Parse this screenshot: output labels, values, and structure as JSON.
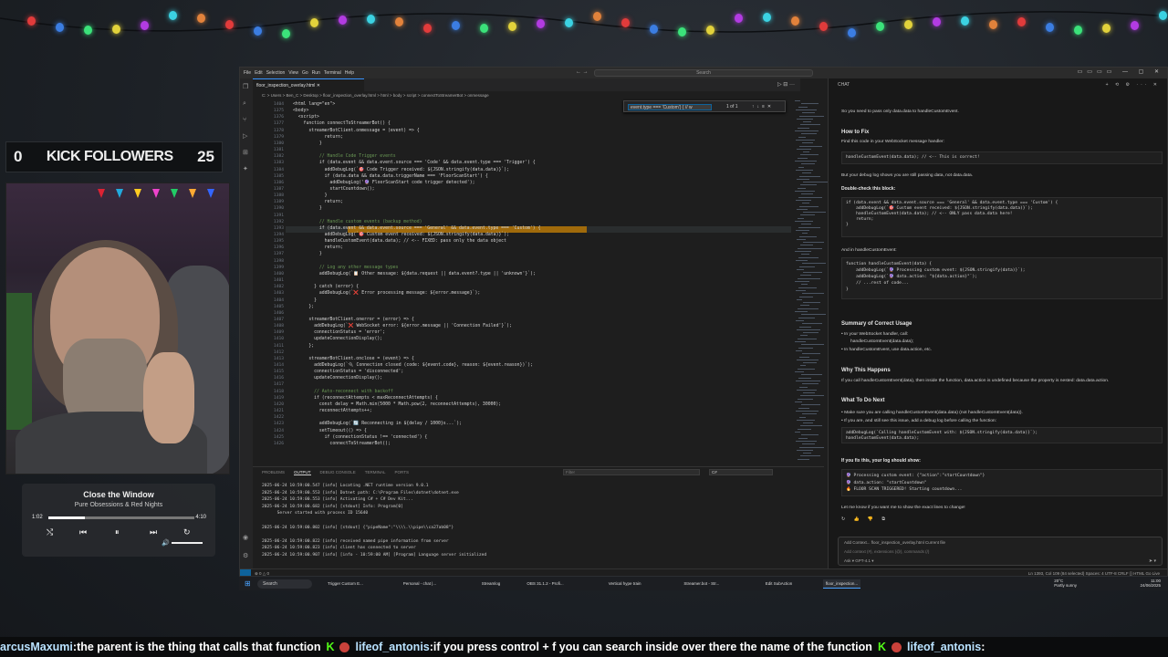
{
  "lights": {
    "colors": [
      "#e23b3b",
      "#3b7de2",
      "#3be27a",
      "#e2d23b",
      "#b23be2",
      "#3bd2e2",
      "#e2823b"
    ]
  },
  "followers": {
    "left": "0",
    "label": "KICK FOLLOWERS",
    "right": "25"
  },
  "player": {
    "title": "Close the Window",
    "artist": "Pure Obsessions & Red Nights",
    "time_current": "1:02",
    "time_total": "4:10",
    "progress": 0.25
  },
  "vscode": {
    "menu": [
      "File",
      "Edit",
      "Selection",
      "View",
      "Go",
      "Run",
      "Terminal",
      "Help"
    ],
    "search_placeholder": "Search",
    "tab": "floor_inspection_overlay.html",
    "breadcrumbs": "C: > Users > Ben_C > Desktop > floor_inspection_overlay.html > html > body > script > connectToStreamerBot > onmessage",
    "find": {
      "query": "event.type === 'Custom') {  // w",
      "count": "1 of 1"
    },
    "code": [
      [
        "1404",
        "<html lang=\"en\">"
      ],
      [
        "1375",
        "<body>"
      ],
      [
        "1376",
        "  <script>"
      ],
      [
        "1377",
        "    function connectToStreamerBot() {"
      ],
      [
        "1378",
        "      streamerBotClient.onmessage = (event) => {"
      ],
      [
        "1379",
        "            return;"
      ],
      [
        "1380",
        "          }"
      ],
      [
        "1381",
        ""
      ],
      [
        "1382",
        "          // Handle Code Trigger events"
      ],
      [
        "1383",
        "          if (data.event && data.event.source === 'Code' && data.event.type === 'Trigger') {"
      ],
      [
        "1384",
        "            addDebugLog(`🎯 Code Trigger received: ${JSON.stringify(data.data)}`);"
      ],
      [
        "1385",
        "            if (data.data && data.data.triggerName === 'FloorScanStart') {"
      ],
      [
        "1386",
        "              addDebugLog('🔮 FloorScanStart code trigger detected');"
      ],
      [
        "1387",
        "              startCountdown();"
      ],
      [
        "1388",
        "            }"
      ],
      [
        "1389",
        "            return;"
      ],
      [
        "1390",
        "          }"
      ],
      [
        "1391",
        ""
      ],
      [
        "1392",
        "          // Handle custom events (backup method)"
      ],
      [
        "1393",
        "          if (data.event && data.event.source === 'General' && data.event.type === 'Custom') {"
      ],
      [
        "1394",
        "            addDebugLog(`🎯 Custom event received: ${JSON.stringify(data.data)}`);"
      ],
      [
        "1395",
        "            handleCustomEvent(data.data); // <-- FIXED: pass only the data object"
      ],
      [
        "1396",
        "            return;"
      ],
      [
        "1397",
        "          }"
      ],
      [
        "1398",
        ""
      ],
      [
        "1399",
        "          // Log any other message types"
      ],
      [
        "1400",
        "          addDebugLog(`📋 Other message: ${data.request || data.event?.type || 'unknown'}`);"
      ],
      [
        "1401",
        ""
      ],
      [
        "1402",
        "        } catch (error) {"
      ],
      [
        "1403",
        "          addDebugLog(`❌ Error processing message: ${error.message}`);"
      ],
      [
        "1404",
        "        }"
      ],
      [
        "1405",
        "      };"
      ],
      [
        "1406",
        ""
      ],
      [
        "1407",
        "      streamerBotClient.onerror = (error) => {"
      ],
      [
        "1408",
        "        addDebugLog(`❌ WebSocket error: ${error.message || 'Connection Failed'}`);"
      ],
      [
        "1409",
        "        connectionStatus = 'error';"
      ],
      [
        "1410",
        "        updateConnectionDisplay();"
      ],
      [
        "1411",
        "      };"
      ],
      [
        "1412",
        ""
      ],
      [
        "1413",
        "      streamerBotClient.onclose = (event) => {"
      ],
      [
        "1414",
        "        addDebugLog(`🔌 Connection closed (code: ${event.code}, reason: ${event.reason})`);"
      ],
      [
        "1415",
        "        connectionStatus = 'disconnected';"
      ],
      [
        "1416",
        "        updateConnectionDisplay();"
      ],
      [
        "1417",
        ""
      ],
      [
        "1418",
        "        // Auto-reconnect with backoff"
      ],
      [
        "1419",
        "        if (reconnectAttempts < maxReconnectAttempts) {"
      ],
      [
        "1420",
        "          const delay = Math.min(5000 * Math.pow(2, reconnectAttempts), 30000);"
      ],
      [
        "1421",
        "          reconnectAttempts++;"
      ],
      [
        "1422",
        ""
      ],
      [
        "1423",
        "          addDebugLog(`🔄 Reconnecting in ${delay / 1000}s...`);"
      ],
      [
        "1424",
        "          setTimeout(() => {"
      ],
      [
        "1425",
        "            if (connectionStatus !== 'connected') {"
      ],
      [
        "1426",
        "              connectToStreamerBot();"
      ]
    ],
    "panel_tabs": [
      "PROBLEMS",
      "OUTPUT",
      "DEBUG CONSOLE",
      "TERMINAL",
      "PORTS"
    ],
    "filter_placeholder": "Filter",
    "output_source": "C#",
    "output": [
      "2025-06-24 10:59:00.547 [info] Locating .NET runtime version 9.0.1",
      "2025-06-24 10:59:00.553 [info] Dotnet path: C:\\Program Files\\dotnet\\dotnet.exe",
      "2025-06-24 10:59:00.553 [info] Activating C# + C# Dev Kit...",
      "2025-06-24 10:59:00.682 [info] [stdout] Info: Program[0]",
      "      Server started with process ID 15640",
      "",
      "2025-06-24 10:59:00.802 [info] [stdout] {\"pipeName\":\"\\\\\\\\.\\\\pipe\\\\ca27ab08\"}",
      "",
      "2025-06-24 10:59:00.822 [info] received named pipe information from server",
      "2025-06-24 10:59:00.823 [info] client has connected to server",
      "2025-06-24 10:59:00.907 [info] [info - 10:59:00 AM] [Program] Language server initialized"
    ],
    "status_left": "⊗ 0 △ 0",
    "status_right": "Ln 1393, Col 109 (84 selected)   Spaces: 4   UTF-8   CRLF   {} HTML   Go Live"
  },
  "chat": {
    "header": "CHAT",
    "intro": "So you need to pass only data.data to handleCustomEvent.",
    "h_fix": "How to Fix",
    "fix_text": "Find this code in your WebSocket message handler:",
    "fix_code": "handleCustomEvent(data.data); // <-- This is correct!",
    "fix_after": "But your debug log shows you are still passing data, not data.data.",
    "h_double": "Double-check this block:",
    "double_code": "if (data.event && data.event.source === 'General' && data.event.type === 'Custom') {\n    addDebugLog(`🎯 Custom event received: ${JSON.stringify(data.data)}`);\n    handleCustomEvent(data.data); // <-- ONLY pass data.data here!\n    return;\n}",
    "and_in": "And in handleCustomEvent:",
    "handler_code": "function handleCustomEvent(data) {\n    addDebugLog(`🔮 Processing custom event: ${JSON.stringify(data)}`);\n    addDebugLog(`🔮 data.action: \"${data.action}\"`);\n    // ...rest of code...\n}",
    "h_summary": "Summary of Correct Usage",
    "summary_1": "In your WebSocket handler, call:",
    "summary_1b": "handleCustomEvent(data.data);",
    "summary_2": "In handleCustomEvent, use data.action, etc.",
    "h_why": "Why This Happens",
    "why_text": "If you call handleCustomEvent(data), then inside the function, data.action is undefined because the property is nested: data.data.action.",
    "h_next": "What To Do Next",
    "next_1": "Make sure you are calling handleCustomEvent(data.data) (not handleCustomEvent(data)).",
    "next_2": "If you are, and still see this issue, add a debug log before calling the function:",
    "next_code": "addDebugLog(`Calling handleCustomEvent with: ${JSON.stringify(data.data)}`);\nhandleCustomEvent(data.data);",
    "h_fixed": "If you fix this, your log should show:",
    "fixed_code": "🔮 Processing custom event: {\"action\":\"startCountdown\"}\n🔮 data.action: \"startCountdown\"\n🔥 FLOOR SCAN TRIGGERED! Starting countdown...",
    "closing": "Let me know if you want me to show the exact lines to change!",
    "input_ctx": "Add Context...   floor_inspection_overlay.html Current file",
    "input_placeholder": "Add context (#), extensions (@), commands (/)",
    "mode": "Ask ▾   GPT-4.1 ▾"
  },
  "taskbar": {
    "search": "Search",
    "items": [
      "Trigger Custom E...",
      "Personal - chat |...",
      "Streamlog",
      "OBS 31.1.2 - Profi...",
      "Vertical hype train",
      "Streamer.bot - Str...",
      "Edit SubAction",
      "floor_inspection..."
    ],
    "weather": "20°C\nPartly sunny",
    "clock": "11:00\n24/06/2025"
  },
  "ticker": [
    {
      "user": "arcusMaxumi",
      "msg": "the parent is the thing that calls that function"
    },
    {
      "user": "lifeof_antonis",
      "msg": "if you press control + f you can search inside over there the name of the function"
    },
    {
      "user": "lifeof_antonis",
      "msg": ""
    }
  ]
}
